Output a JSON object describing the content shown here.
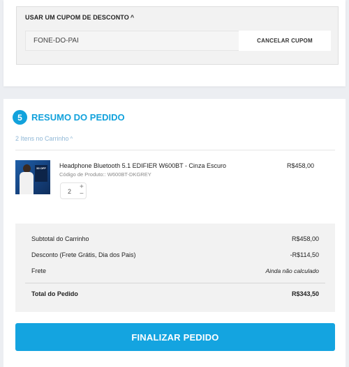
{
  "coupon": {
    "title": "USAR UM CUPOM DE DESCONTO",
    "value": "FONE-DO-PAI",
    "cancel_label": "CANCELAR CUPOM"
  },
  "summary_section": {
    "step_number": "5",
    "title": "RESUMO DO PEDIDO",
    "items_toggle": "2 Itens no Carrinho"
  },
  "product": {
    "name": "Headphone Bluetooth 5.1 EDIFIER W600BT - Cinza Escuro",
    "code": "Código de Produto:: W600BT-DKGREY",
    "price": "R$458,00",
    "quantity": "2",
    "image_badge": "50 OFF"
  },
  "totals": {
    "subtotal_label": "Subtotal do Carrinho",
    "subtotal_value": "R$458,00",
    "discount_label": "Desconto (Frete Grátis, Dia dos Pais)",
    "discount_value": "-R$114,50",
    "shipping_label": "Frete",
    "shipping_value": "Ainda não calculado",
    "total_label": "Total do Pedido",
    "total_value": "R$343,50"
  },
  "actions": {
    "finalize_label": "FINALIZAR PEDIDO"
  },
  "colors": {
    "accent": "#12a2dc",
    "button": "#14a4e0"
  },
  "icons": {
    "coupon_toggle": "chevron-up-icon",
    "items_toggle": "chevron-up-icon",
    "qty_increase": "plus-icon",
    "qty_decrease": "minus-icon"
  }
}
